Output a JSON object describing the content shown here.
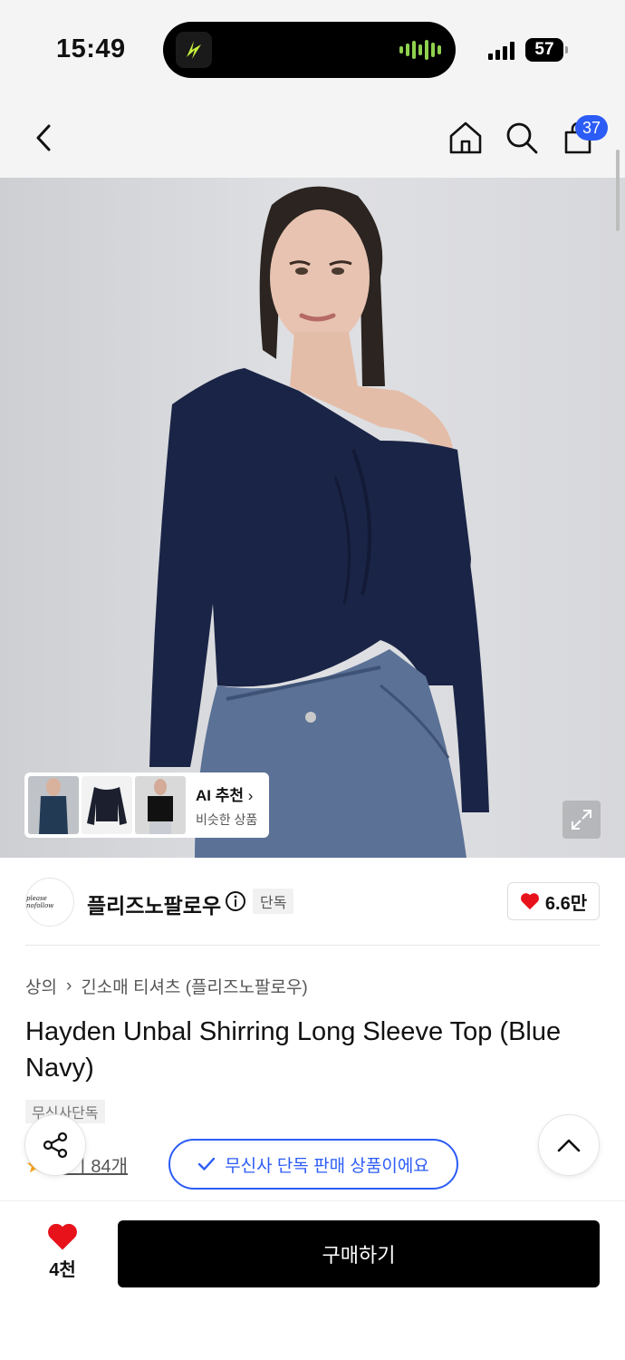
{
  "status_bar": {
    "time": "15:49",
    "battery": "57"
  },
  "header": {
    "back_icon": "chevron-left-icon",
    "home_icon": "home-icon",
    "search_icon": "search-icon",
    "cart_icon": "shopping-bag-icon",
    "cart_count": "37"
  },
  "ai_recommend": {
    "title": "AI 추천",
    "subtitle": "비슷한 상품"
  },
  "brand": {
    "logo_text": "please nofollow",
    "name": "플리즈노팔로우",
    "exclusive_badge": "단독",
    "likes": "6.6만"
  },
  "breadcrumb": {
    "category": "상의",
    "subcategory": "긴소매 티셔츠 (플리즈노팔로우)"
  },
  "product": {
    "title": "Hayden Unbal Shirring Long Sleeve Top (Blue Navy)",
    "tag": "무신사단독",
    "rating_obscured": "",
    "reviews": "후기 84개"
  },
  "toast": {
    "message": "무신사 단독 판매 상품이에요"
  },
  "bottom_bar": {
    "like_count": "4천",
    "buy_label": "구매하기"
  },
  "colors": {
    "accent_blue": "#2c5cf6",
    "heart_red": "#e8121b",
    "buy_button": "#000000"
  }
}
